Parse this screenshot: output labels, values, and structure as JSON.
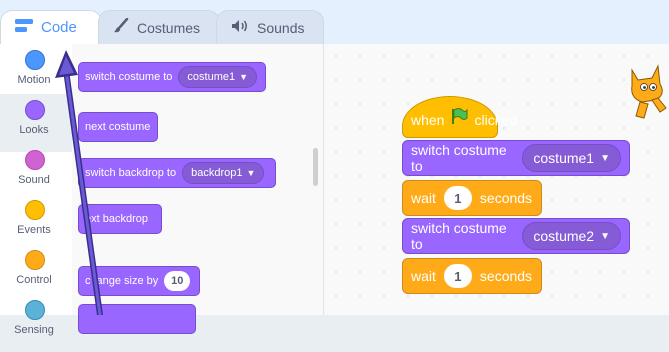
{
  "tabs": [
    {
      "label": "Code",
      "icon": "code-icon"
    },
    {
      "label": "Costumes",
      "icon": "brush-icon"
    },
    {
      "label": "Sounds",
      "icon": "speaker-icon"
    }
  ],
  "categories": [
    {
      "label": "Motion",
      "color": "#4c97ff"
    },
    {
      "label": "Looks",
      "color": "#9966ff"
    },
    {
      "label": "Sound",
      "color": "#cf63cf"
    },
    {
      "label": "Events",
      "color": "#ffbf00"
    },
    {
      "label": "Control",
      "color": "#ffab19"
    },
    {
      "label": "Sensing",
      "color": "#5cb1d6"
    }
  ],
  "palette": {
    "switch_costume": {
      "text": "switch costume to",
      "menu": "costume1"
    },
    "next_costume": "next costume",
    "switch_backdrop": {
      "text": "switch backdrop to",
      "menu": "backdrop1"
    },
    "next_backdrop": "ext backdrop",
    "change_size": {
      "text_a": "c",
      "text_b": "ange size by",
      "value": "10"
    }
  },
  "script": {
    "hat": {
      "when": "when",
      "clicked": "clicked"
    },
    "switch1": {
      "text": "switch costume to",
      "menu": "costume1"
    },
    "wait1": {
      "text": "wait",
      "value": "1",
      "unit": "seconds"
    },
    "switch2": {
      "text": "switch costume to",
      "menu": "costume2"
    },
    "wait2": {
      "text": "wait",
      "value": "1",
      "unit": "seconds"
    }
  }
}
